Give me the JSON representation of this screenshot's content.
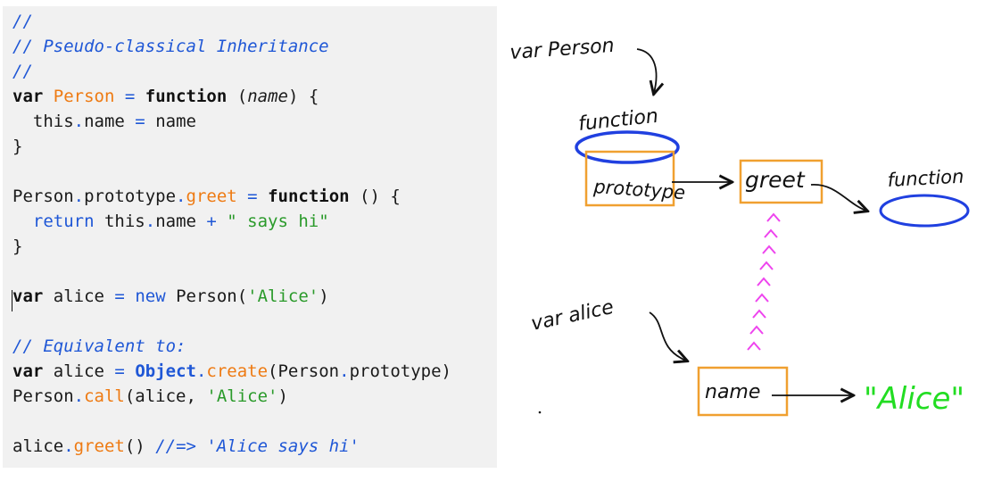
{
  "code": {
    "lines": [
      [
        {
          "t": "//",
          "c": "comment"
        }
      ],
      [
        {
          "t": "// Pseudo-classical Inheritance",
          "c": "comment"
        }
      ],
      [
        {
          "t": "//",
          "c": "comment"
        }
      ],
      [
        {
          "t": "var",
          "c": "kw"
        },
        {
          "t": " ",
          "c": "plain"
        },
        {
          "t": "Person",
          "c": "orange"
        },
        {
          "t": " ",
          "c": "plain"
        },
        {
          "t": "=",
          "c": "op"
        },
        {
          "t": " ",
          "c": "plain"
        },
        {
          "t": "function",
          "c": "kw"
        },
        {
          "t": " (",
          "c": "plain"
        },
        {
          "t": "name",
          "c": "param"
        },
        {
          "t": ") {",
          "c": "plain"
        }
      ],
      [
        {
          "t": "  this",
          "c": "plain"
        },
        {
          "t": ".",
          "c": "op"
        },
        {
          "t": "name ",
          "c": "plain"
        },
        {
          "t": "=",
          "c": "op"
        },
        {
          "t": " name",
          "c": "plain"
        }
      ],
      [
        {
          "t": "}",
          "c": "plain"
        }
      ],
      [],
      [
        {
          "t": "Person",
          "c": "plain"
        },
        {
          "t": ".",
          "c": "op"
        },
        {
          "t": "prototype",
          "c": "plain"
        },
        {
          "t": ".",
          "c": "op"
        },
        {
          "t": "greet",
          "c": "orange"
        },
        {
          "t": " ",
          "c": "plain"
        },
        {
          "t": "=",
          "c": "op"
        },
        {
          "t": " ",
          "c": "plain"
        },
        {
          "t": "function",
          "c": "kw"
        },
        {
          "t": " () {",
          "c": "plain"
        }
      ],
      [
        {
          "t": "  ",
          "c": "plain"
        },
        {
          "t": "return",
          "c": "blue"
        },
        {
          "t": " this",
          "c": "plain"
        },
        {
          "t": ".",
          "c": "op"
        },
        {
          "t": "name ",
          "c": "plain"
        },
        {
          "t": "+",
          "c": "op"
        },
        {
          "t": " ",
          "c": "plain"
        },
        {
          "t": "\" says hi\"",
          "c": "green"
        }
      ],
      [
        {
          "t": "}",
          "c": "plain"
        }
      ],
      [],
      [
        {
          "t": "var",
          "c": "kw"
        },
        {
          "t": " alice ",
          "c": "plain"
        },
        {
          "t": "=",
          "c": "op"
        },
        {
          "t": " ",
          "c": "plain"
        },
        {
          "t": "new",
          "c": "blue"
        },
        {
          "t": " Person(",
          "c": "plain"
        },
        {
          "t": "'Alice'",
          "c": "green"
        },
        {
          "t": ")",
          "c": "plain"
        }
      ],
      [],
      [
        {
          "t": "// Equivalent to:",
          "c": "comment"
        }
      ],
      [
        {
          "t": "var",
          "c": "kw"
        },
        {
          "t": " alice ",
          "c": "plain"
        },
        {
          "t": "=",
          "c": "op"
        },
        {
          "t": " ",
          "c": "plain"
        },
        {
          "t": "Object",
          "c": "obj"
        },
        {
          "t": ".",
          "c": "op"
        },
        {
          "t": "create",
          "c": "orange"
        },
        {
          "t": "(Person",
          "c": "plain"
        },
        {
          "t": ".",
          "c": "op"
        },
        {
          "t": "prototype)",
          "c": "plain"
        }
      ],
      [
        {
          "t": "Person",
          "c": "plain"
        },
        {
          "t": ".",
          "c": "op"
        },
        {
          "t": "call",
          "c": "orange"
        },
        {
          "t": "(alice, ",
          "c": "plain"
        },
        {
          "t": "'Alice'",
          "c": "green"
        },
        {
          "t": ")",
          "c": "plain"
        }
      ],
      [],
      [
        {
          "t": "alice",
          "c": "plain"
        },
        {
          "t": ".",
          "c": "op"
        },
        {
          "t": "greet",
          "c": "orange"
        },
        {
          "t": "() ",
          "c": "plain"
        },
        {
          "t": "//=> 'Alice says hi'",
          "c": "comment"
        }
      ]
    ]
  },
  "diagram": {
    "var_person_label": "var Person",
    "function_label_1": "function",
    "prototype_label": "prototype",
    "greet_label": "greet",
    "function_label_2": "function",
    "var_alice_label": "var alice",
    "name_label": "name",
    "alice_value": "\"Alice\"",
    "colors": {
      "box": "#f0a030",
      "ellipse": "#2040e0",
      "proto_link": "#ee44ee",
      "value": "#22dd22",
      "ink": "#111111"
    }
  }
}
